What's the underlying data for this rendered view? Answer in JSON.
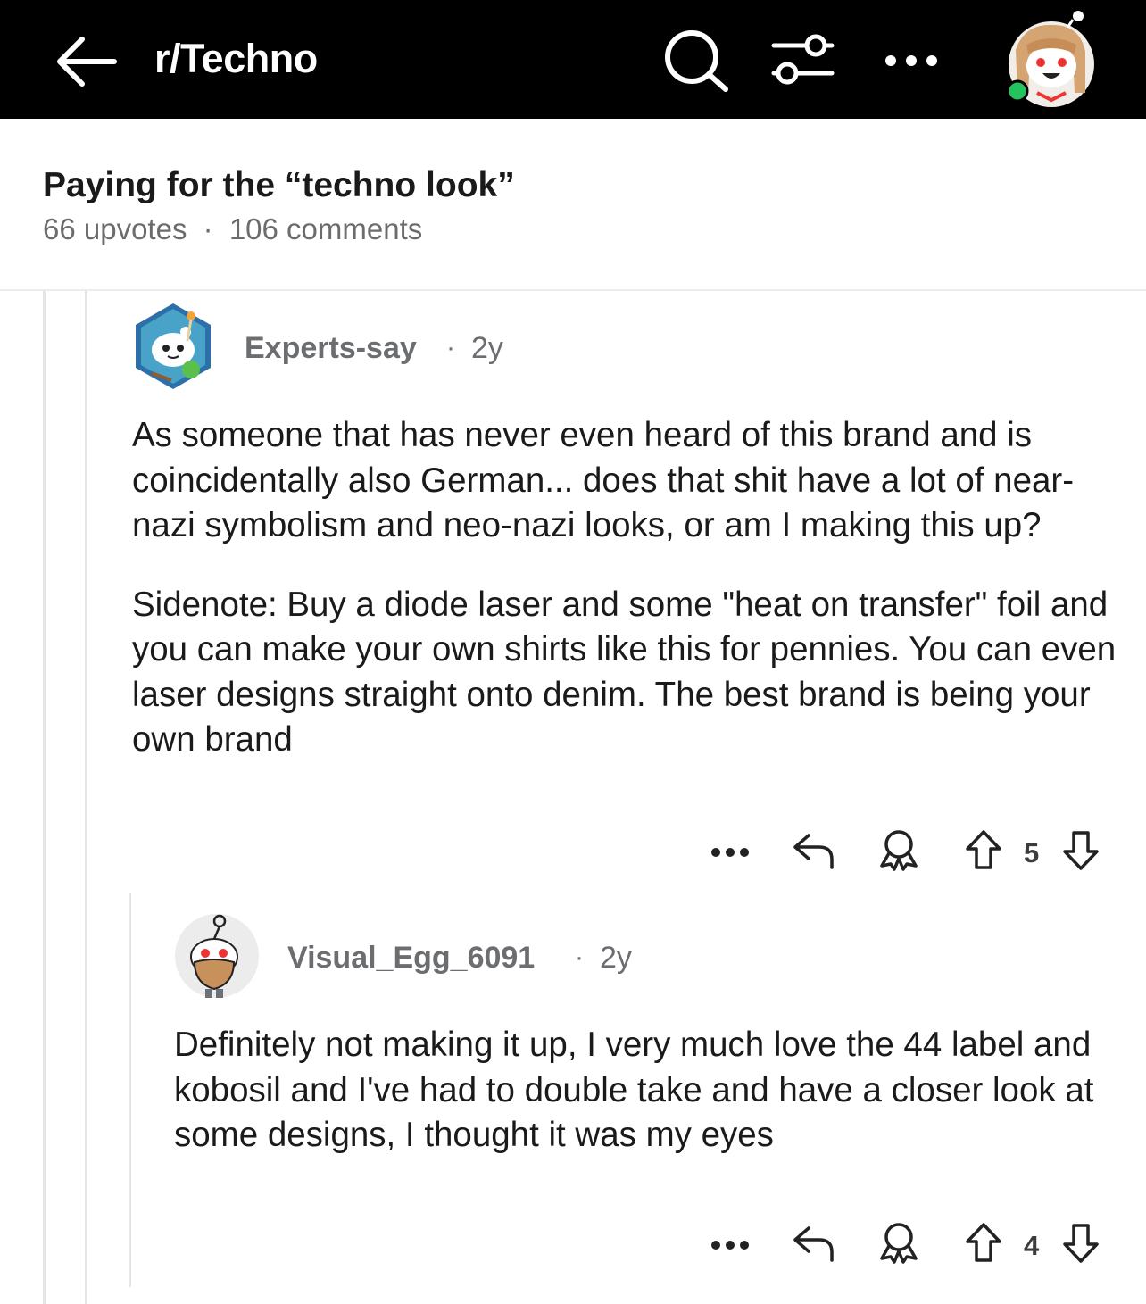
{
  "header": {
    "subreddit": "r/Techno",
    "icons": [
      "back-arrow-icon",
      "search-icon",
      "filter-icon",
      "more-icon",
      "user-avatar"
    ]
  },
  "post": {
    "title": "Paying for the “techno look”",
    "upvotes": "66 upvotes",
    "separator": "·",
    "comments": "106 comments"
  },
  "comments": [
    {
      "author": "Experts-say",
      "separator": "·",
      "age": "2y",
      "body": [
        "As someone that has never even heard of this brand and is coincidentally also German... does that shit have a lot of near-nazi symbolism and neo-nazi looks, or am I making this up?",
        "Sidenote: Buy a diode laser and some \"heat on transfer\" foil and you can make your own shirts like this for pennies. You can even laser designs straight onto denim. The best brand is being your own brand"
      ],
      "score": "5"
    },
    {
      "author": "Visual_Egg_6091",
      "separator": "·",
      "age": "2y",
      "body": [
        "Definitely not making it up, I very much love the 44 label and kobosil and I've had to double take and have a closer look at some designs, I thought it was my eyes"
      ],
      "score": "4"
    }
  ],
  "colors": {
    "topbar": "#000000",
    "meta_text": "#6a6c6e",
    "thread_line": "#e5e5e5",
    "online_dot": "#2ecc71"
  }
}
